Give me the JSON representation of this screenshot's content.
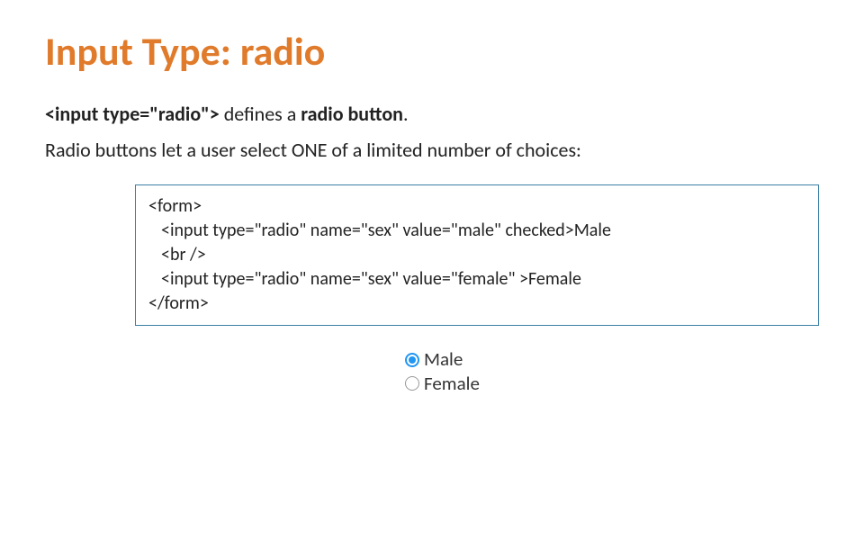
{
  "title": "Input Type: radio",
  "desc": {
    "tag": "<input type=\"radio\">",
    "text1": " defines a ",
    "bold": "radio button",
    "dot": ".",
    "line2": "Radio buttons let a user select ONE of a limited number of choices:"
  },
  "code": {
    "l1": "<form>",
    "l2": "<input type=\"radio\" name=\"sex\" value=\"male\" checked>Male",
    "l3": "<br />",
    "l4": "<input type=\"radio\" name=\"sex\" value=\"female\" >Female",
    "l5": "</form>"
  },
  "demo": {
    "options": [
      {
        "label": "Male",
        "checked": true
      },
      {
        "label": "Female",
        "checked": false
      }
    ]
  }
}
